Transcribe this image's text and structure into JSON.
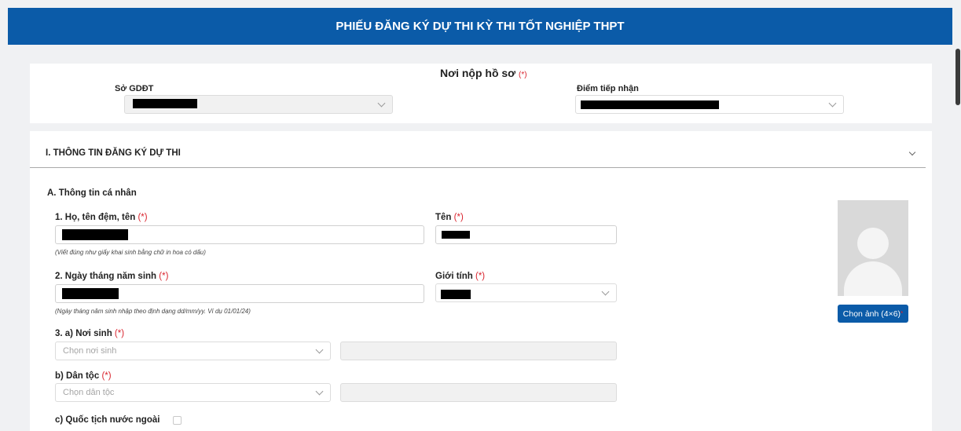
{
  "header": {
    "title": "PHIẾU ĐĂNG KÝ DỰ THI KỲ THI TỐT NGHIỆP THPT"
  },
  "submission": {
    "title": "Nơi nộp hồ sơ",
    "required_mark": "(*)",
    "department_label": "Sở GDĐT",
    "receiving_point_label": "Điểm tiếp nhận"
  },
  "section1": {
    "title": "I. THÔNG TIN ĐĂNG KÝ DỰ THI",
    "subsection": "A. Thông tin cá nhân",
    "full_name_label": "1. Họ, tên đệm, tên",
    "full_name_hint": "(Viết đúng như giấy khai sinh bằng chữ in hoa có dấu)",
    "first_name_label": "Tên",
    "dob_label": "2. Ngày tháng năm sinh",
    "dob_hint": "(Ngày tháng năm sinh nhập theo định dạng dd/mm/yy. Ví dụ 01/01/24)",
    "gender_label": "Giới tính",
    "birthplace_label": "3. a) Nơi sinh",
    "birthplace_placeholder": "Chọn nơi sinh",
    "ethnicity_label": "b) Dân tộc",
    "ethnicity_placeholder": "Chọn dân tộc",
    "foreign_label": "c) Quốc tịch nước ngoài",
    "photo_button": "Chọn ảnh (4×6)",
    "required_mark": "(*)",
    "photo_required": "*"
  },
  "colors": {
    "brand": "#0b5ba8",
    "required": "#d9232d"
  }
}
